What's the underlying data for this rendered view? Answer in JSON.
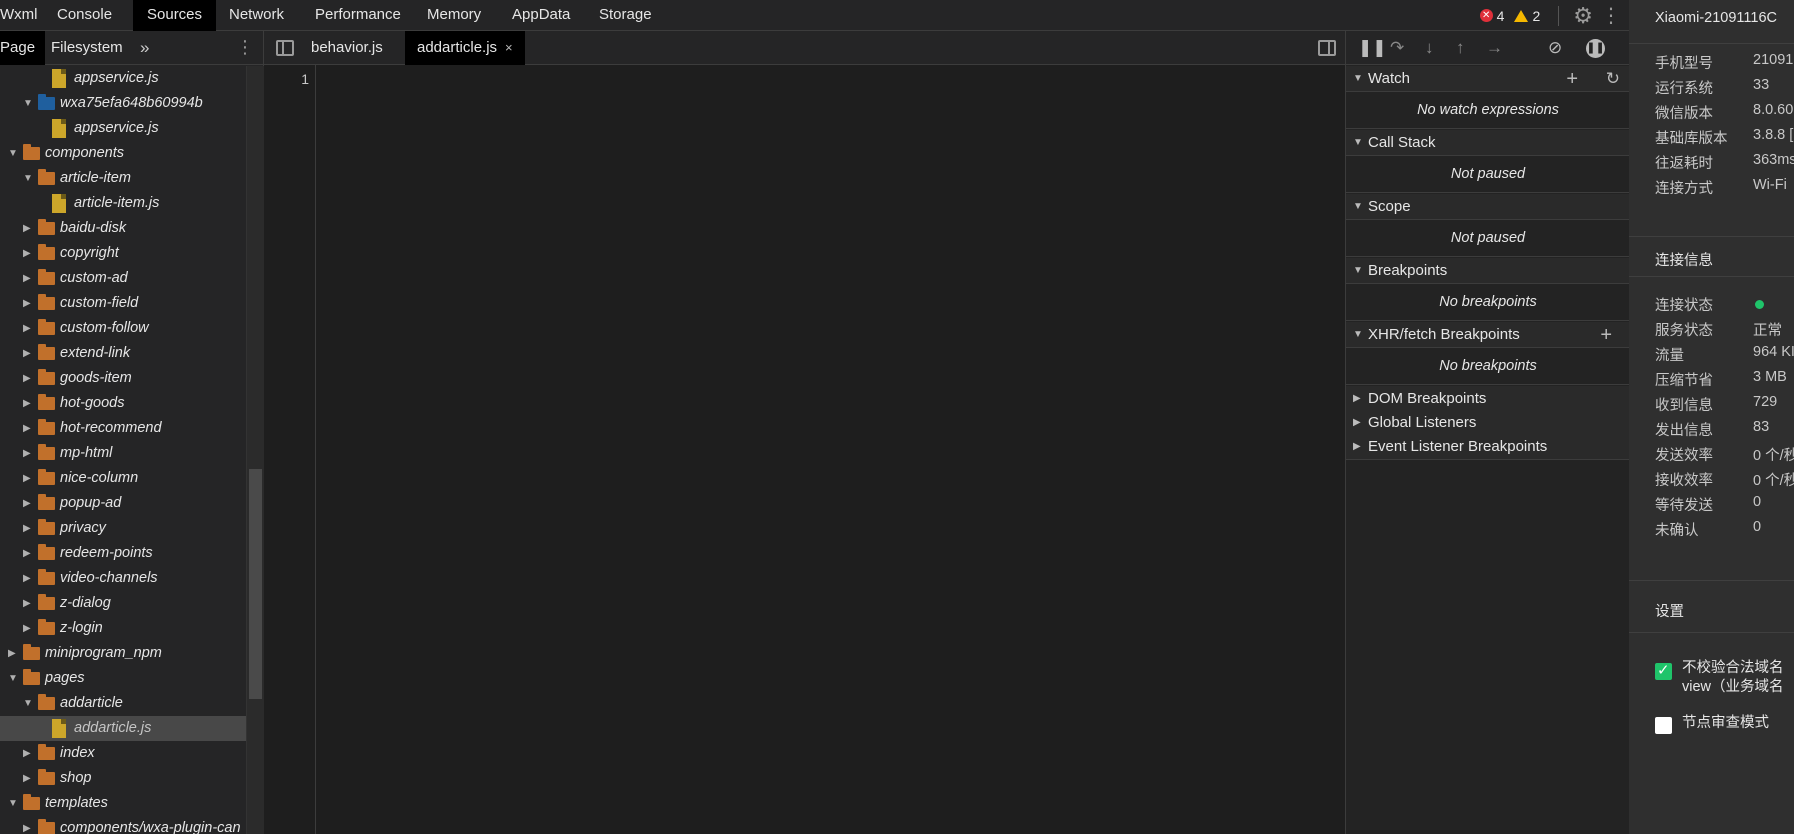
{
  "top_tabs": [
    "Wxml",
    "Console",
    "Sources",
    "Network",
    "Performance",
    "Memory",
    "AppData",
    "Storage"
  ],
  "active_tab": "Sources",
  "status": {
    "errors": "4",
    "warnings": "2"
  },
  "navigator": {
    "tabs": [
      "Page",
      "Filesystem"
    ],
    "tree": [
      {
        "label": "appservice.js",
        "type": "file",
        "indent": 3
      },
      {
        "label": "wxa75efa648b60994b",
        "type": "folder-blue",
        "indent": 2,
        "expanded": true
      },
      {
        "label": "appservice.js",
        "type": "file",
        "indent": 3
      },
      {
        "label": "components",
        "type": "folder",
        "indent": 1,
        "expanded": true
      },
      {
        "label": "article-item",
        "type": "folder",
        "indent": 2,
        "expanded": true
      },
      {
        "label": "article-item.js",
        "type": "file",
        "indent": 3
      },
      {
        "label": "baidu-disk",
        "type": "folder",
        "indent": 2
      },
      {
        "label": "copyright",
        "type": "folder",
        "indent": 2
      },
      {
        "label": "custom-ad",
        "type": "folder",
        "indent": 2
      },
      {
        "label": "custom-field",
        "type": "folder",
        "indent": 2
      },
      {
        "label": "custom-follow",
        "type": "folder",
        "indent": 2
      },
      {
        "label": "extend-link",
        "type": "folder",
        "indent": 2
      },
      {
        "label": "goods-item",
        "type": "folder",
        "indent": 2
      },
      {
        "label": "hot-goods",
        "type": "folder",
        "indent": 2
      },
      {
        "label": "hot-recommend",
        "type": "folder",
        "indent": 2
      },
      {
        "label": "mp-html",
        "type": "folder",
        "indent": 2
      },
      {
        "label": "nice-column",
        "type": "folder",
        "indent": 2
      },
      {
        "label": "popup-ad",
        "type": "folder",
        "indent": 2
      },
      {
        "label": "privacy",
        "type": "folder",
        "indent": 2
      },
      {
        "label": "redeem-points",
        "type": "folder",
        "indent": 2
      },
      {
        "label": "video-channels",
        "type": "folder",
        "indent": 2
      },
      {
        "label": "z-dialog",
        "type": "folder",
        "indent": 2
      },
      {
        "label": "z-login",
        "type": "folder",
        "indent": 2
      },
      {
        "label": "miniprogram_npm",
        "type": "folder",
        "indent": 1
      },
      {
        "label": "pages",
        "type": "folder",
        "indent": 1,
        "expanded": true
      },
      {
        "label": "addarticle",
        "type": "folder",
        "indent": 2,
        "expanded": true
      },
      {
        "label": "addarticle.js",
        "type": "file",
        "indent": 3,
        "selected": true
      },
      {
        "label": "index",
        "type": "folder",
        "indent": 2
      },
      {
        "label": "shop",
        "type": "folder",
        "indent": 2
      },
      {
        "label": "templates",
        "type": "folder",
        "indent": 1,
        "expanded": true
      },
      {
        "label": "components/wxa-plugin-can",
        "type": "folder",
        "indent": 2
      }
    ]
  },
  "editor": {
    "tabs": [
      {
        "label": "behavior.js",
        "active": false,
        "closable": false
      },
      {
        "label": "addarticle.js",
        "active": true,
        "closable": true
      }
    ],
    "close_glyph": "×",
    "line_numbers": [
      "1"
    ]
  },
  "debugger": {
    "sections": [
      {
        "title": "Watch",
        "expanded": true,
        "message": "No watch expressions",
        "actions": [
          "+",
          "↻"
        ]
      },
      {
        "title": "Call Stack",
        "expanded": true,
        "message": "Not paused"
      },
      {
        "title": "Scope",
        "expanded": true,
        "message": "Not paused"
      },
      {
        "title": "Breakpoints",
        "expanded": true,
        "message": "No breakpoints"
      },
      {
        "title": "XHR/fetch Breakpoints",
        "expanded": true,
        "message": "No breakpoints",
        "actions": [
          "+"
        ]
      },
      {
        "title": "DOM Breakpoints",
        "expanded": false
      },
      {
        "title": "Global Listeners",
        "expanded": false
      },
      {
        "title": "Event Listener Breakpoints",
        "expanded": false
      }
    ]
  },
  "device_panel": {
    "title": "Xiaomi-21091116C",
    "info": [
      {
        "k": "手机型号",
        "v": "21091"
      },
      {
        "k": "运行系统",
        "v": "33"
      },
      {
        "k": "微信版本",
        "v": "8.0.60"
      },
      {
        "k": "基础库版本",
        "v": "3.8.8 ["
      },
      {
        "k": "往返耗时",
        "v": "363ms"
      },
      {
        "k": "连接方式",
        "v": "Wi-Fi"
      }
    ],
    "conn_heading": "连接信息",
    "conn": [
      {
        "k": "连接状态",
        "v": ""
      },
      {
        "k": "服务状态",
        "v": "正常"
      },
      {
        "k": "流量",
        "v": "964 KI"
      },
      {
        "k": "压缩节省",
        "v": "3 MB"
      },
      {
        "k": "收到信息",
        "v": "729"
      },
      {
        "k": "发出信息",
        "v": "83"
      },
      {
        "k": "发送效率",
        "v": "0 个/秒"
      },
      {
        "k": "接收效率",
        "v": "0 个/秒"
      },
      {
        "k": "等待发送",
        "v": "0"
      },
      {
        "k": "未确认",
        "v": "0"
      }
    ],
    "settings_heading": "设置",
    "checkbox1": {
      "line1": "不校验合法域名",
      "line2": "view（业务域名",
      "checked": true
    },
    "checkbox2": {
      "label": "节点审查模式",
      "checked": false
    }
  }
}
